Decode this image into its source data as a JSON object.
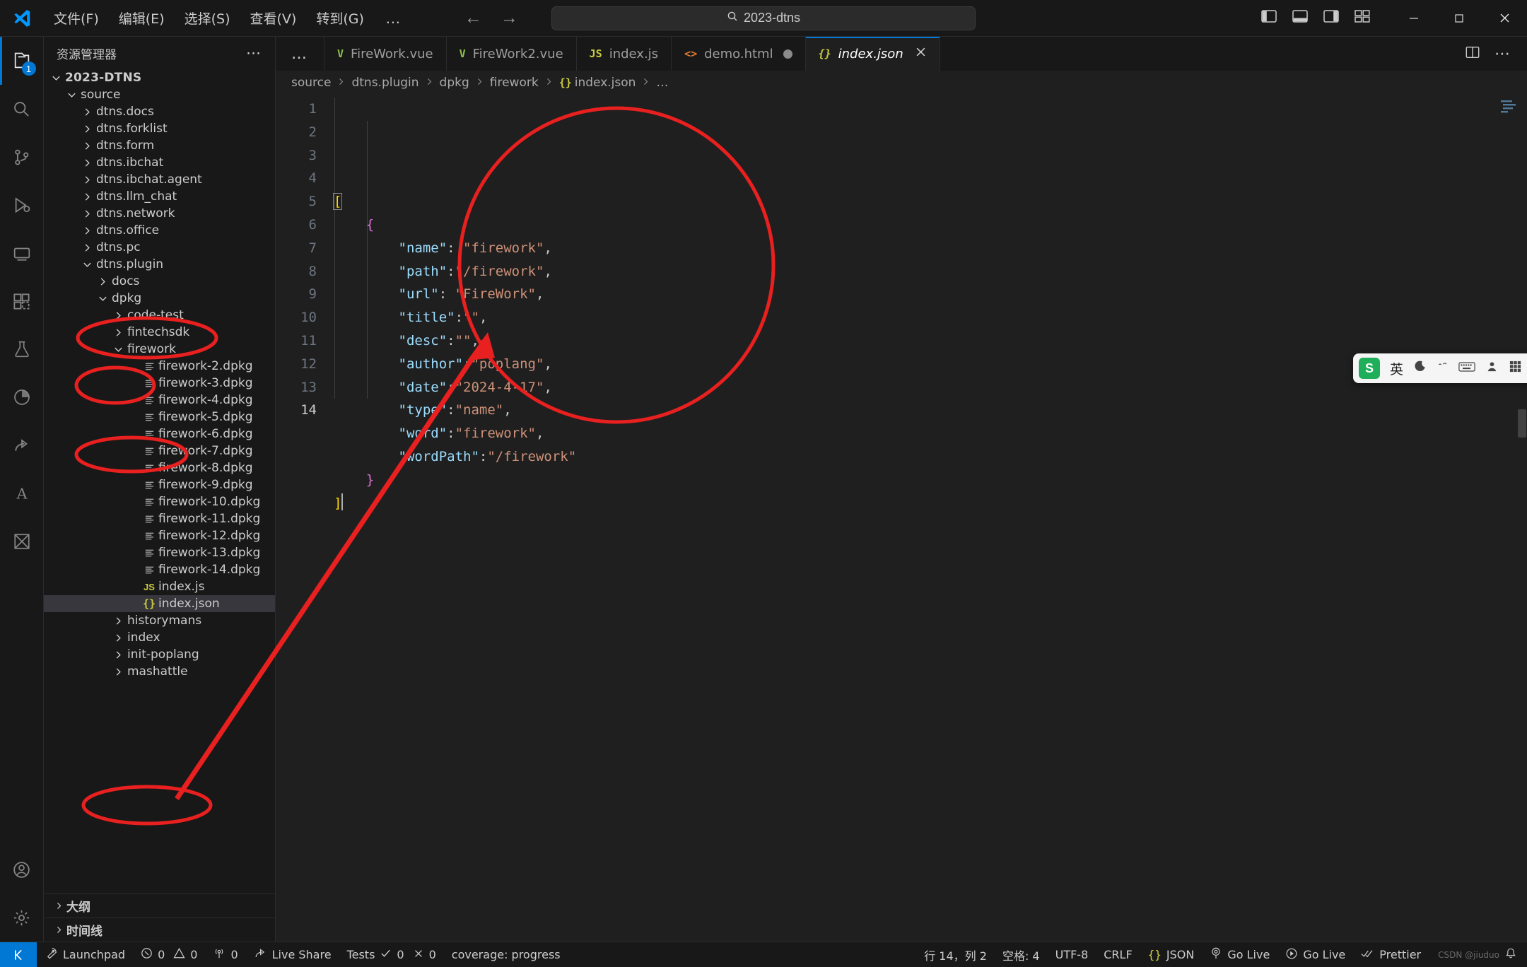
{
  "titlebar": {
    "menus": [
      "文件(F)",
      "编辑(E)",
      "选择(S)",
      "查看(V)",
      "转到(G)"
    ],
    "more": "…",
    "back_icon": "arrow-left-icon",
    "forward_icon": "arrow-right-icon",
    "command_center_text": "2023-dtns",
    "search_icon": "search-icon",
    "minimize_label": "─",
    "maximize_label": "□",
    "close_label": "✕"
  },
  "activitybar": {
    "items": [
      {
        "name": "explorer",
        "icon": "files-icon",
        "badge": "1",
        "active": true
      },
      {
        "name": "search",
        "icon": "search-icon",
        "badge": "",
        "active": false
      },
      {
        "name": "source-control",
        "icon": "source-control-icon",
        "badge": "",
        "active": false
      },
      {
        "name": "run-debug",
        "icon": "run-debug-icon",
        "badge": "",
        "active": false
      },
      {
        "name": "remote-explorer",
        "icon": "remote-explorer-icon",
        "badge": "",
        "active": false
      },
      {
        "name": "extensions",
        "icon": "extensions-icon",
        "badge": "",
        "active": false
      },
      {
        "name": "testing",
        "icon": "beaker-icon",
        "badge": "",
        "active": false
      },
      {
        "name": "coverage",
        "icon": "coverage-icon",
        "badge": "",
        "active": false
      },
      {
        "name": "live-share",
        "icon": "live-share-icon",
        "badge": "",
        "active": false
      },
      {
        "name": "translate",
        "icon": "letter-a-icon",
        "badge": "",
        "active": false
      },
      {
        "name": "jupyter",
        "icon": "jupyter-icon",
        "badge": "",
        "active": false
      }
    ],
    "bottom": [
      {
        "name": "accounts",
        "icon": "account-icon"
      },
      {
        "name": "settings",
        "icon": "gear-icon"
      }
    ]
  },
  "sidebar": {
    "title": "资源管理器",
    "actions_icon": "more-actions-icon",
    "tree": [
      {
        "label": "2023-DTNS",
        "depth": 0,
        "twisty": "down",
        "kind": "root"
      },
      {
        "label": "source",
        "depth": 1,
        "twisty": "down",
        "kind": "folder"
      },
      {
        "label": "dtns.docs",
        "depth": 2,
        "twisty": "right",
        "kind": "folder"
      },
      {
        "label": "dtns.forklist",
        "depth": 2,
        "twisty": "right",
        "kind": "folder"
      },
      {
        "label": "dtns.form",
        "depth": 2,
        "twisty": "right",
        "kind": "folder"
      },
      {
        "label": "dtns.ibchat",
        "depth": 2,
        "twisty": "right",
        "kind": "folder"
      },
      {
        "label": "dtns.ibchat.agent",
        "depth": 2,
        "twisty": "right",
        "kind": "folder"
      },
      {
        "label": "dtns.llm_chat",
        "depth": 2,
        "twisty": "right",
        "kind": "folder"
      },
      {
        "label": "dtns.network",
        "depth": 2,
        "twisty": "right",
        "kind": "folder"
      },
      {
        "label": "dtns.office",
        "depth": 2,
        "twisty": "right",
        "kind": "folder"
      },
      {
        "label": "dtns.pc",
        "depth": 2,
        "twisty": "right",
        "kind": "folder"
      },
      {
        "label": "dtns.plugin",
        "depth": 2,
        "twisty": "down",
        "kind": "folder"
      },
      {
        "label": "docs",
        "depth": 3,
        "twisty": "right",
        "kind": "folder"
      },
      {
        "label": "dpkg",
        "depth": 3,
        "twisty": "down",
        "kind": "folder"
      },
      {
        "label": "code-test",
        "depth": 4,
        "twisty": "right",
        "kind": "folder"
      },
      {
        "label": "fintechsdk",
        "depth": 4,
        "twisty": "right",
        "kind": "folder"
      },
      {
        "label": "firework",
        "depth": 4,
        "twisty": "down",
        "kind": "folder"
      },
      {
        "label": "firework-2.dpkg",
        "depth": 5,
        "twisty": "none",
        "kind": "dpkg"
      },
      {
        "label": "firework-3.dpkg",
        "depth": 5,
        "twisty": "none",
        "kind": "dpkg"
      },
      {
        "label": "firework-4.dpkg",
        "depth": 5,
        "twisty": "none",
        "kind": "dpkg"
      },
      {
        "label": "firework-5.dpkg",
        "depth": 5,
        "twisty": "none",
        "kind": "dpkg"
      },
      {
        "label": "firework-6.dpkg",
        "depth": 5,
        "twisty": "none",
        "kind": "dpkg"
      },
      {
        "label": "firework-7.dpkg",
        "depth": 5,
        "twisty": "none",
        "kind": "dpkg"
      },
      {
        "label": "firework-8.dpkg",
        "depth": 5,
        "twisty": "none",
        "kind": "dpkg"
      },
      {
        "label": "firework-9.dpkg",
        "depth": 5,
        "twisty": "none",
        "kind": "dpkg"
      },
      {
        "label": "firework-10.dpkg",
        "depth": 5,
        "twisty": "none",
        "kind": "dpkg"
      },
      {
        "label": "firework-11.dpkg",
        "depth": 5,
        "twisty": "none",
        "kind": "dpkg"
      },
      {
        "label": "firework-12.dpkg",
        "depth": 5,
        "twisty": "none",
        "kind": "dpkg"
      },
      {
        "label": "firework-13.dpkg",
        "depth": 5,
        "twisty": "none",
        "kind": "dpkg"
      },
      {
        "label": "firework-14.dpkg",
        "depth": 5,
        "twisty": "none",
        "kind": "dpkg"
      },
      {
        "label": "index.js",
        "depth": 5,
        "twisty": "none",
        "kind": "js"
      },
      {
        "label": "index.json",
        "depth": 5,
        "twisty": "none",
        "kind": "json",
        "selected": true
      },
      {
        "label": "historymans",
        "depth": 4,
        "twisty": "right",
        "kind": "folder"
      },
      {
        "label": "index",
        "depth": 4,
        "twisty": "right",
        "kind": "folder"
      },
      {
        "label": "init-poplang",
        "depth": 4,
        "twisty": "right",
        "kind": "folder"
      },
      {
        "label": "mashattle",
        "depth": 4,
        "twisty": "right",
        "kind": "folder"
      }
    ],
    "sections": [
      {
        "label": "大纲",
        "twisty": "right"
      },
      {
        "label": "时间线",
        "twisty": "right"
      }
    ]
  },
  "editor": {
    "tabs": [
      {
        "label": "FireWork.vue",
        "icon": "vue-icon",
        "icon_text": "V",
        "icon_class": "vue",
        "active": false,
        "dirty": false
      },
      {
        "label": "FireWork2.vue",
        "icon": "vue-icon",
        "icon_text": "V",
        "icon_class": "vue",
        "active": false,
        "dirty": false
      },
      {
        "label": "index.js",
        "icon": "js-icon",
        "icon_text": "JS",
        "icon_class": "js",
        "active": false,
        "dirty": false
      },
      {
        "label": "demo.html",
        "icon": "html-icon",
        "icon_text": "<>",
        "icon_class": "html",
        "active": false,
        "dirty": true
      },
      {
        "label": "index.json",
        "icon": "json-icon",
        "icon_text": "{}",
        "icon_class": "json",
        "active": true,
        "dirty": false
      }
    ],
    "tab_overflow": "…",
    "split_icon": "split-editor-icon",
    "more_icon": "editor-actions-more-icon",
    "close_icon": "close-icon",
    "breadcrumbs": [
      {
        "text": "source",
        "icon": ""
      },
      {
        "text": "dtns.plugin",
        "icon": ""
      },
      {
        "text": "dpkg",
        "icon": ""
      },
      {
        "text": "firework",
        "icon": ""
      },
      {
        "text": "index.json",
        "icon": "{}"
      },
      {
        "text": "…",
        "icon": ""
      }
    ],
    "line_numbers": [
      "1",
      "2",
      "3",
      "4",
      "5",
      "6",
      "7",
      "8",
      "9",
      "10",
      "11",
      "12",
      "13",
      "14"
    ],
    "current_line": "14",
    "code_lines": [
      {
        "indent": 0,
        "parts": [
          {
            "t": "[",
            "c": "tok-brace1"
          }
        ]
      },
      {
        "indent": 1,
        "parts": [
          {
            "t": "{",
            "c": "tok-brace2"
          }
        ]
      },
      {
        "indent": 2,
        "parts": [
          {
            "t": "\"name\"",
            "c": "tok-key"
          },
          {
            "t": ": ",
            "c": "tok-punct"
          },
          {
            "t": "\"firework\"",
            "c": "tok-str"
          },
          {
            "t": ",",
            "c": "tok-punct"
          }
        ]
      },
      {
        "indent": 2,
        "parts": [
          {
            "t": "\"path\"",
            "c": "tok-key"
          },
          {
            "t": ":",
            "c": "tok-punct"
          },
          {
            "t": "\"/firework\"",
            "c": "tok-str"
          },
          {
            "t": ",",
            "c": "tok-punct"
          }
        ]
      },
      {
        "indent": 2,
        "parts": [
          {
            "t": "\"url\"",
            "c": "tok-key"
          },
          {
            "t": ": ",
            "c": "tok-punct"
          },
          {
            "t": "\"FireWork\"",
            "c": "tok-str"
          },
          {
            "t": ",",
            "c": "tok-punct"
          }
        ]
      },
      {
        "indent": 2,
        "parts": [
          {
            "t": "\"title\"",
            "c": "tok-key"
          },
          {
            "t": ":",
            "c": "tok-punct"
          },
          {
            "t": "\"\"",
            "c": "tok-str"
          },
          {
            "t": ",",
            "c": "tok-punct"
          }
        ]
      },
      {
        "indent": 2,
        "parts": [
          {
            "t": "\"desc\"",
            "c": "tok-key"
          },
          {
            "t": ":",
            "c": "tok-punct"
          },
          {
            "t": "\"\"",
            "c": "tok-str"
          },
          {
            "t": ",",
            "c": "tok-punct"
          }
        ]
      },
      {
        "indent": 2,
        "parts": [
          {
            "t": "\"author\"",
            "c": "tok-key"
          },
          {
            "t": ":",
            "c": "tok-punct"
          },
          {
            "t": "\"poplang\"",
            "c": "tok-str"
          },
          {
            "t": ",",
            "c": "tok-punct"
          }
        ]
      },
      {
        "indent": 2,
        "parts": [
          {
            "t": "\"date\"",
            "c": "tok-key"
          },
          {
            "t": ":",
            "c": "tok-punct"
          },
          {
            "t": "\"2024-4-17\"",
            "c": "tok-str"
          },
          {
            "t": ",",
            "c": "tok-punct"
          }
        ]
      },
      {
        "indent": 2,
        "parts": [
          {
            "t": "\"type\"",
            "c": "tok-key"
          },
          {
            "t": ":",
            "c": "tok-punct"
          },
          {
            "t": "\"name\"",
            "c": "tok-str"
          },
          {
            "t": ",",
            "c": "tok-punct"
          }
        ]
      },
      {
        "indent": 2,
        "parts": [
          {
            "t": "\"word\"",
            "c": "tok-key"
          },
          {
            "t": ":",
            "c": "tok-punct"
          },
          {
            "t": "\"firework\"",
            "c": "tok-str"
          },
          {
            "t": ",",
            "c": "tok-punct"
          }
        ]
      },
      {
        "indent": 2,
        "parts": [
          {
            "t": "\"wordPath\"",
            "c": "tok-key"
          },
          {
            "t": ":",
            "c": "tok-punct"
          },
          {
            "t": "\"/firework\"",
            "c": "tok-str"
          }
        ]
      },
      {
        "indent": 1,
        "parts": [
          {
            "t": "}",
            "c": "tok-brace2"
          }
        ]
      },
      {
        "indent": 0,
        "parts": [
          {
            "t": "]",
            "c": "tok-brace1"
          }
        ]
      }
    ]
  },
  "ime": {
    "logo_text": "S",
    "mode": "英",
    "moon_icon": "moon-icon",
    "voice_icon": "voice-icon",
    "keyboard_icon": "keyboard-icon",
    "user_icon": "user-icon",
    "apps_icon": "apps-grid-icon"
  },
  "statusbar": {
    "remote_icon": "remote-window-icon",
    "left": [
      {
        "icon": "rocket-icon",
        "text": "Launchpad"
      },
      {
        "icon": "error-icon",
        "text": "0",
        "icon2": "warning-icon",
        "text2": "0"
      },
      {
        "icon": "radio-tower-icon",
        "text": "0"
      },
      {
        "icon": "live-share-icon",
        "text": "Live Share"
      },
      {
        "icon": "",
        "text": "Tests",
        "icon2": "check-icon",
        "text2": "0",
        "icon3": "x-icon",
        "text3": "0"
      },
      {
        "icon": "",
        "text": "coverage: progress"
      }
    ],
    "right": [
      {
        "icon": "",
        "text": "行 14，列 2"
      },
      {
        "icon": "",
        "text": "空格: 4"
      },
      {
        "icon": "",
        "text": "UTF-8"
      },
      {
        "icon": "",
        "text": "CRLF"
      },
      {
        "icon": "{}",
        "text": "JSON"
      },
      {
        "icon": "broadcast-icon",
        "text": "Go Live"
      },
      {
        "icon": "play-circle-icon",
        "text": "Go Live"
      },
      {
        "icon": "check-all-icon",
        "text": "Prettier"
      },
      {
        "icon": "bell-icon",
        "text": ""
      }
    ],
    "watermark": "CSDN @jiuduo"
  },
  "annotations": {
    "color": "#e8201f",
    "ellipses": [
      "dtns.plugin",
      "dpkg",
      "firework",
      "index.json"
    ],
    "code_circle": "json-object-body",
    "arrow": "index-json-to-code"
  }
}
